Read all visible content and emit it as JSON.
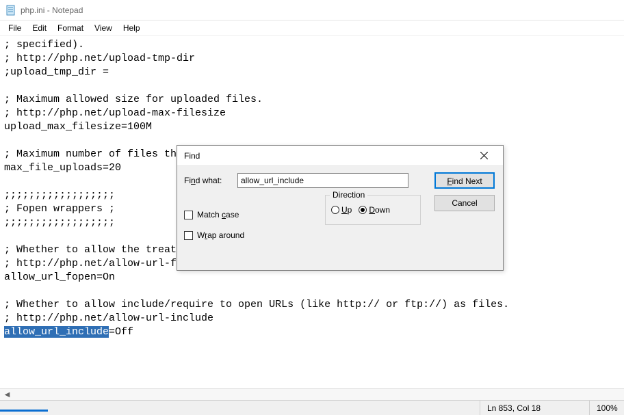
{
  "window": {
    "title": "php.ini - Notepad"
  },
  "menu": {
    "file": "File",
    "edit": "Edit",
    "format": "Format",
    "view": "View",
    "help": "Help"
  },
  "editor": {
    "lines": [
      "; specified).",
      "; http://php.net/upload-tmp-dir",
      ";upload_tmp_dir =",
      "",
      "; Maximum allowed size for uploaded files.",
      "; http://php.net/upload-max-filesize",
      "upload_max_filesize=100M",
      "",
      "; Maximum number of files that can be uploaded via a single request",
      "max_file_uploads=20",
      "",
      ";;;;;;;;;;;;;;;;;;",
      "; Fopen wrappers ;",
      ";;;;;;;;;;;;;;;;;;",
      "",
      "; Whether to allow the treatment of URLs (like http:// or ftp://) as files.",
      "; http://php.net/allow-url-fopen",
      "allow_url_fopen=On",
      "",
      "; Whether to allow include/require to open URLs (like http:// or ftp://) as files.",
      "; http://php.net/allow-url-include"
    ],
    "selected_line_prefix": "allow_url_include",
    "selected_line_suffix": "=Off"
  },
  "find": {
    "title": "Find",
    "label": "Find what:",
    "value": "allow_url_include",
    "direction_label": "Direction",
    "up": "Up",
    "down": "Down",
    "direction_selected": "Down",
    "match_case": "Match case",
    "wrap_around": "Wrap around",
    "find_next": "Find Next",
    "cancel": "Cancel"
  },
  "status": {
    "position": "Ln 853, Col 18",
    "zoom": "100%"
  }
}
